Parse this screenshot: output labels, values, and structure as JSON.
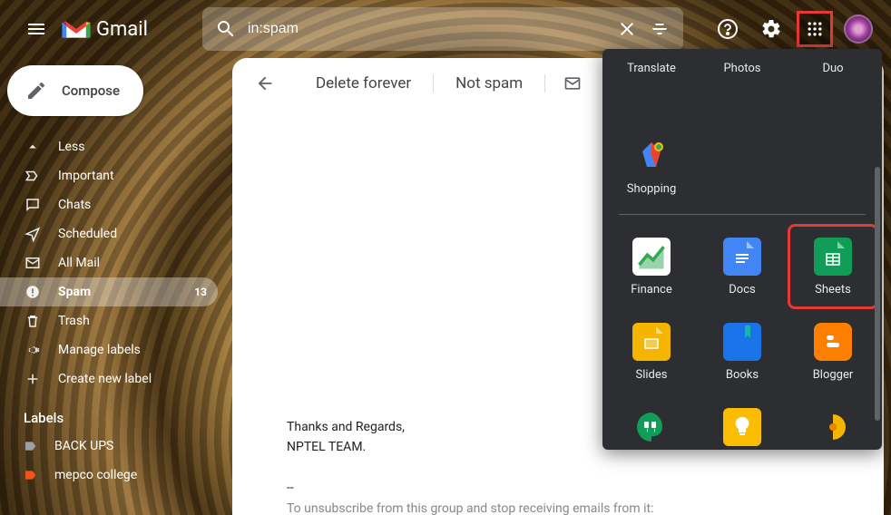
{
  "header": {
    "brand": "Gmail",
    "search_value": "in:spam"
  },
  "compose_label": "Compose",
  "sidebar": {
    "items": [
      {
        "icon": "chevron-up",
        "label": "Less"
      },
      {
        "icon": "important",
        "label": "Important"
      },
      {
        "icon": "chat",
        "label": "Chats"
      },
      {
        "icon": "scheduled",
        "label": "Scheduled"
      },
      {
        "icon": "allmail",
        "label": "All Mail"
      },
      {
        "icon": "spam",
        "label": "Spam",
        "count": "13",
        "active": true
      },
      {
        "icon": "trash",
        "label": "Trash"
      },
      {
        "icon": "gear",
        "label": "Manage labels"
      },
      {
        "icon": "plus",
        "label": "Create new label"
      }
    ],
    "labels_header": "Labels",
    "labels": [
      {
        "label": "BACK UPS",
        "color": "#9aa0a6"
      },
      {
        "label": "mepco college",
        "color": "#f4511e"
      }
    ]
  },
  "toolbar": {
    "delete_forever": "Delete forever",
    "not_spam": "Not spam"
  },
  "email": {
    "line1": "Thanks and Regards,",
    "line2": "NPTEL TEAM.",
    "sep": "--",
    "unsubscribe": "To unsubscribe from this group and stop receiving emails from it:"
  },
  "apps": {
    "row0": [
      {
        "label": "Translate"
      },
      {
        "label": "Photos"
      },
      {
        "label": "Duo"
      }
    ],
    "row1": [
      {
        "label": "Shopping"
      }
    ],
    "row2": [
      {
        "label": "Finance",
        "color": "#34a853"
      },
      {
        "label": "Docs",
        "color": "#4285f4"
      },
      {
        "label": "Sheets",
        "color": "#0f9d58",
        "highlight": true
      }
    ],
    "row3": [
      {
        "label": "Slides",
        "color": "#f4b400"
      },
      {
        "label": "Books",
        "color": "#1a73e8"
      },
      {
        "label": "Blogger",
        "color": "#ff8000"
      }
    ],
    "row4": [
      {
        "label": "Hangouts",
        "color": "#0f9d58"
      },
      {
        "label": "Keep",
        "color": "#fbbc04"
      },
      {
        "label": "Jamboard",
        "color": "#f4b400"
      }
    ]
  }
}
